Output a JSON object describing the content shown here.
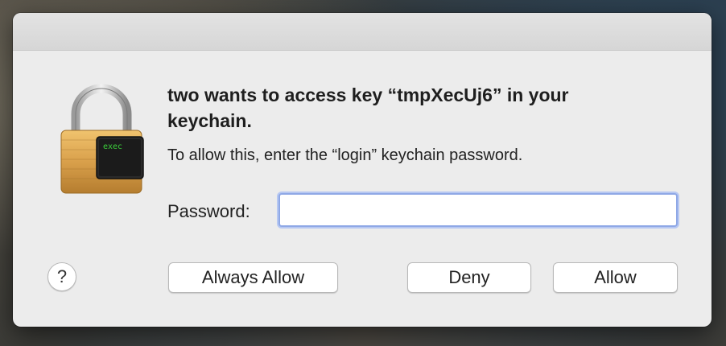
{
  "dialog": {
    "heading": "two wants to access key “tmpXecUj6” in your keychain.",
    "message": "To allow this, enter the “login” keychain password.",
    "icon_label": "exec",
    "password": {
      "label": "Password:",
      "value": "",
      "placeholder": ""
    },
    "help_label": "?",
    "buttons": {
      "always_allow": "Always Allow",
      "deny": "Deny",
      "allow": "Allow"
    }
  },
  "colors": {
    "dialog_bg": "#ececec",
    "focus_ring": "#8fa8e6",
    "terminal_text": "#3bd33b"
  },
  "icons": [
    "keychain-lock-icon",
    "terminal-exec-icon",
    "help-icon"
  ]
}
